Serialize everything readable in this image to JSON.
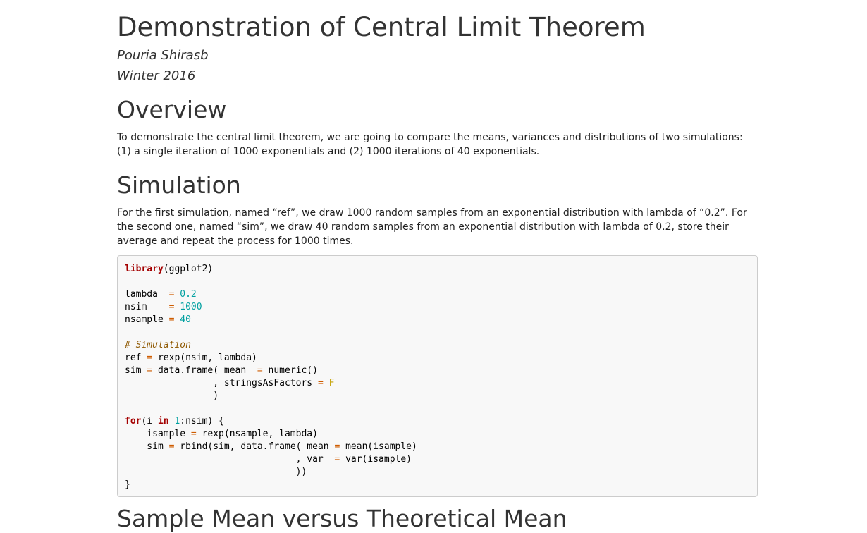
{
  "title": "Demonstration of Central Limit Theorem",
  "author": "Pouria Shirasb",
  "date": "Winter 2016",
  "sections": {
    "overview": {
      "heading": "Overview",
      "text": "To demonstrate the central limit theorem, we are going to compare the means, variances and distributions of two simulations: (1) a single iteration of 1000 exponentials and (2) 1000 iterations of 40 exponentials."
    },
    "simulation": {
      "heading": "Simulation",
      "text": "For the first simulation, named “ref”, we draw 1000 random samples from an exponential distribution with lambda of “0.2”. For the second one, named “sim”, we draw 40 random samples from an exponential distribution with lambda of 0.2, store their average and repeat the process for 1000 times."
    },
    "sample_mean": {
      "heading": "Sample Mean versus Theoretical Mean"
    }
  },
  "code": {
    "l1_kw": "library",
    "l1_rest": "(ggplot2)",
    "l3_var": "lambda  ",
    "l3_op": "=",
    "l3_val": "0.2",
    "l4_var": "nsim    ",
    "l4_op": "=",
    "l4_val": "1000",
    "l5_var": "nsample ",
    "l5_op": "=",
    "l5_val": "40",
    "l7_comment": "# Simulation",
    "l8_a": "ref ",
    "l8_op": "=",
    "l8_b": " rexp(nsim, lambda)",
    "l9_a": "sim ",
    "l9_op1": "=",
    "l9_b": " data.frame( mean  ",
    "l9_op2": "=",
    "l9_c": " numeric()",
    "l10_a": "                , stringsAsFactors ",
    "l10_op": "=",
    "l10_val": "F",
    "l11": "                )",
    "l13_kw1": "for",
    "l13_a": "(i ",
    "l13_kw2": "in",
    "l13_num": "1",
    "l13_b": ":nsim) {",
    "l14_a": "    isample ",
    "l14_op": "=",
    "l14_b": " rexp(nsample, lambda)",
    "l15_a": "    sim ",
    "l15_op1": "=",
    "l15_b": " rbind(sim, data.frame( mean ",
    "l15_op2": "=",
    "l15_c": " mean(isample)",
    "l16_a": "                               , var  ",
    "l16_op": "=",
    "l16_b": " var(isample)",
    "l17": "                               ))",
    "l18": "}"
  }
}
